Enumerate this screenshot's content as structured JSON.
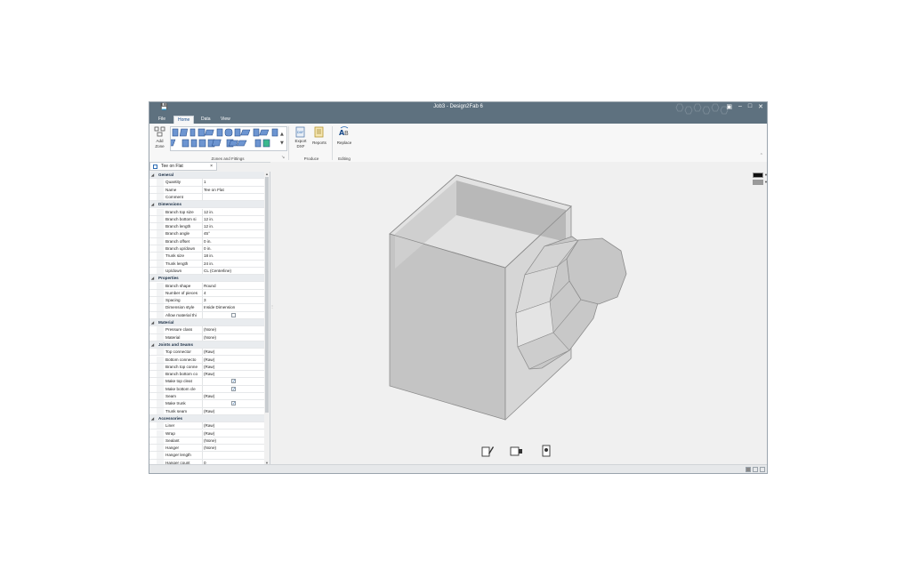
{
  "window": {
    "title": "Job3 - Design2Fab 6"
  },
  "ribbon": {
    "tabs": [
      "File",
      "Home",
      "Data",
      "View"
    ],
    "active_tab": "Home",
    "add_zone": {
      "line1": "Add",
      "line2": "Zone"
    },
    "groups": {
      "zones_fittings": "Zones and Fittings",
      "produce": "Produce",
      "editing": "Editing"
    },
    "export_dxf": {
      "line1": "Export",
      "line2": "DXF"
    },
    "reports": "Reports",
    "replace": "Replace"
  },
  "document_tab": {
    "label": "Tee on Flat",
    "close": "×"
  },
  "properties": {
    "categories": [
      {
        "name": "General",
        "rows": [
          {
            "key": "Quantity",
            "value": "1"
          },
          {
            "key": "Name",
            "value": "Tee on Flat"
          },
          {
            "key": "Comment",
            "value": ""
          }
        ]
      },
      {
        "name": "Dimensions",
        "rows": [
          {
            "key": "Branch top size",
            "value": "12 in."
          },
          {
            "key": "Branch bottom si",
            "value": "12 in."
          },
          {
            "key": "Branch length",
            "value": "12 in."
          },
          {
            "key": "Branch angle",
            "value": "45°"
          },
          {
            "key": "Branch offset",
            "value": "0 in."
          },
          {
            "key": "Branch up/down",
            "value": "0 in."
          },
          {
            "key": "Trunk size",
            "value": "18 in."
          },
          {
            "key": "Trunk length",
            "value": "24 in."
          },
          {
            "key": "Up/down",
            "value": "CL (Centerline)"
          }
        ]
      },
      {
        "name": "Properties",
        "rows": [
          {
            "key": "Branch shape",
            "value": "Round"
          },
          {
            "key": "Number of pieces",
            "value": "4"
          },
          {
            "key": "Spacing",
            "value": "3"
          },
          {
            "key": "Dimension style",
            "value": "Inside Dimension"
          },
          {
            "key": "Allow material thi",
            "value": "",
            "checkbox": "unchecked"
          }
        ]
      },
      {
        "name": "Material",
        "rows": [
          {
            "key": "Pressure class",
            "value": "(None)"
          },
          {
            "key": "Material",
            "value": "(None)"
          }
        ]
      },
      {
        "name": "Joints and Seams",
        "rows": [
          {
            "key": "Top connector",
            "value": "(Raw)"
          },
          {
            "key": "Bottom connecto",
            "value": "(Raw)"
          },
          {
            "key": "Branch top conne",
            "value": "(Raw)"
          },
          {
            "key": "Branch bottom co",
            "value": "(Raw)"
          },
          {
            "key": "Make top cleat",
            "value": "",
            "checkbox": "checked"
          },
          {
            "key": "Make bottom cle",
            "value": "",
            "checkbox": "checked"
          },
          {
            "key": "Seam",
            "value": "(Raw)"
          },
          {
            "key": "Make trunk",
            "value": "",
            "checkbox": "checked"
          },
          {
            "key": "Trunk seam",
            "value": "(Raw)"
          }
        ]
      },
      {
        "name": "Accessories",
        "rows": [
          {
            "key": "Liner",
            "value": "(Raw)"
          },
          {
            "key": "Wrap",
            "value": "(Raw)"
          },
          {
            "key": "Sealant",
            "value": "(None)"
          },
          {
            "key": "Hanger",
            "value": "(None)"
          },
          {
            "key": "Hanger length",
            "value": ""
          },
          {
            "key": "Hanger count",
            "value": "0"
          }
        ]
      }
    ]
  },
  "viewport": {
    "model": "tee-on-flat-3d",
    "swatch_colors": [
      "#111111",
      "#9a9a9a"
    ],
    "view_buttons": [
      "edit-view-icon",
      "side-view-icon",
      "top-view-icon"
    ]
  },
  "colors": {
    "title_bar": "#5e717f",
    "accent": "#1b4c8a",
    "model_face": "#c9c9c9"
  }
}
